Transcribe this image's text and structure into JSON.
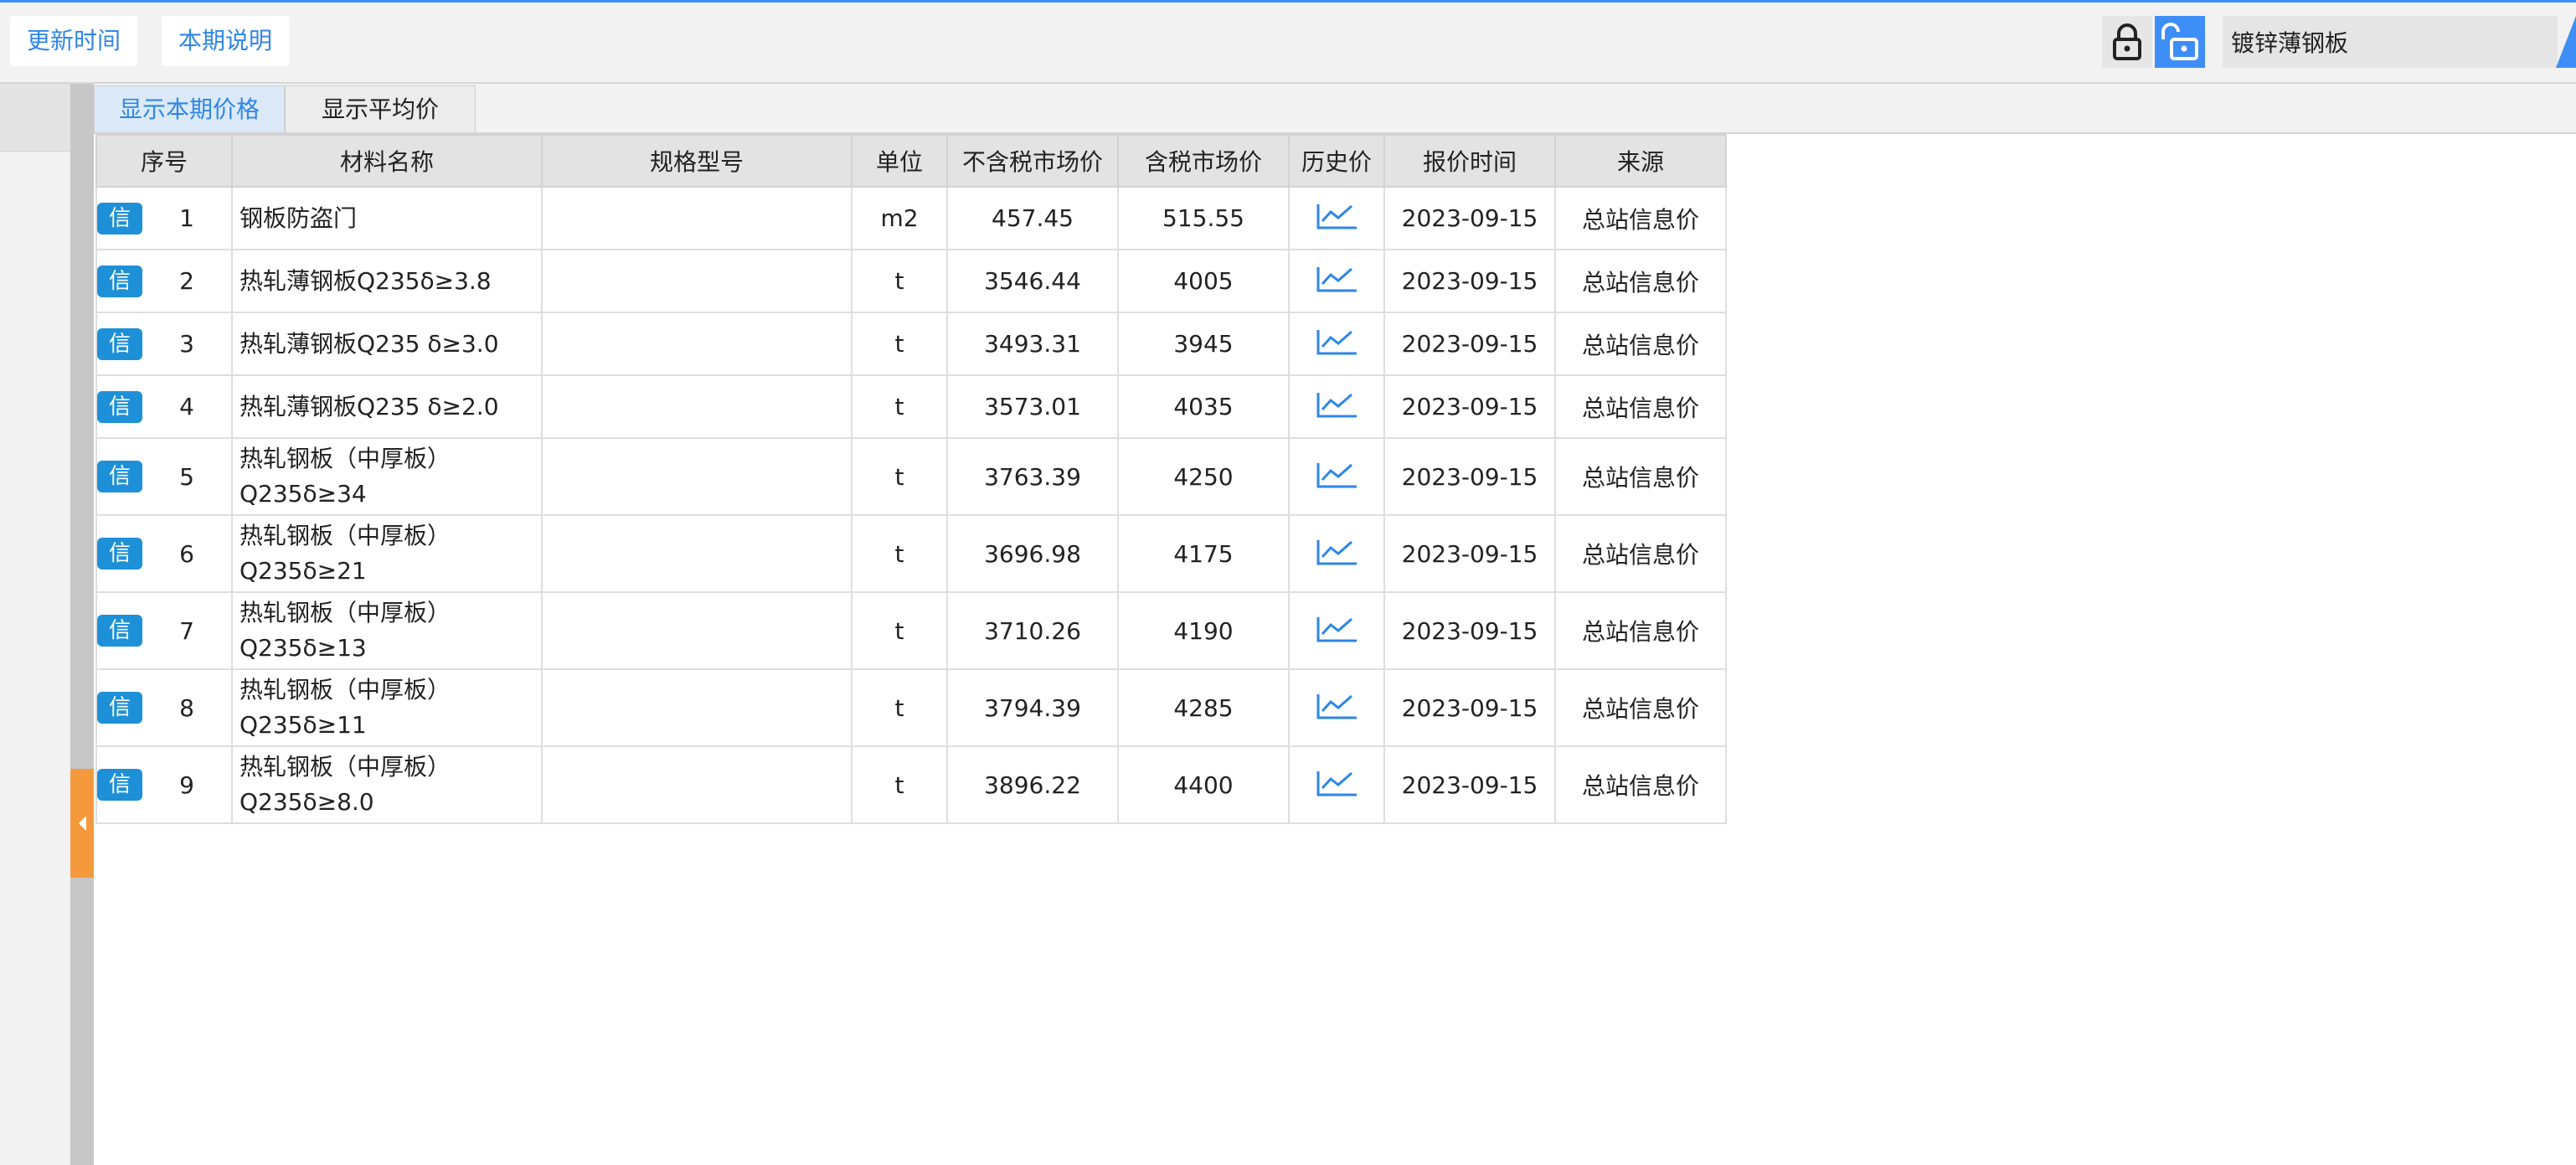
{
  "toolbar": {
    "update_label": "更新时间",
    "notes_label": "本期说明",
    "search_value": "镀锌薄钢板"
  },
  "tabs": {
    "current": "显示本期价格",
    "average": "显示平均价"
  },
  "table": {
    "headers": [
      "序号",
      "材料名称",
      "规格型号",
      "单位",
      "不含税市场价",
      "含税市场价",
      "历史价",
      "报价时间",
      "来源"
    ],
    "badge": "信",
    "rows": [
      {
        "seq": "1",
        "name_line1": "钢板防盗门",
        "name_line2": "",
        "spec": "",
        "unit": "m2",
        "price_ex": "457.45",
        "price_inc": "515.55",
        "date": "2023-09-15",
        "source": "总站信息价"
      },
      {
        "seq": "2",
        "name_line1": "热轧薄钢板Q235δ≥3.8",
        "name_line2": "",
        "spec": "",
        "unit": "t",
        "price_ex": "3546.44",
        "price_inc": "4005",
        "date": "2023-09-15",
        "source": "总站信息价"
      },
      {
        "seq": "3",
        "name_line1": "热轧薄钢板Q235 δ≥3.0",
        "name_line2": "",
        "spec": "",
        "unit": "t",
        "price_ex": "3493.31",
        "price_inc": "3945",
        "date": "2023-09-15",
        "source": "总站信息价"
      },
      {
        "seq": "4",
        "name_line1": "热轧薄钢板Q235 δ≥2.0",
        "name_line2": "",
        "spec": "",
        "unit": "t",
        "price_ex": "3573.01",
        "price_inc": "4035",
        "date": "2023-09-15",
        "source": "总站信息价"
      },
      {
        "seq": "5",
        "name_line1": "热轧钢板（中厚板）",
        "name_line2": "Q235δ≥34",
        "spec": "",
        "unit": "t",
        "price_ex": "3763.39",
        "price_inc": "4250",
        "date": "2023-09-15",
        "source": "总站信息价"
      },
      {
        "seq": "6",
        "name_line1": "热轧钢板（中厚板）",
        "name_line2": "Q235δ≥21",
        "spec": "",
        "unit": "t",
        "price_ex": "3696.98",
        "price_inc": "4175",
        "date": "2023-09-15",
        "source": "总站信息价"
      },
      {
        "seq": "7",
        "name_line1": "热轧钢板（中厚板）",
        "name_line2": "Q235δ≥13",
        "spec": "",
        "unit": "t",
        "price_ex": "3710.26",
        "price_inc": "4190",
        "date": "2023-09-15",
        "source": "总站信息价"
      },
      {
        "seq": "8",
        "name_line1": "热轧钢板（中厚板）",
        "name_line2": "Q235δ≥11",
        "spec": "",
        "unit": "t",
        "price_ex": "3794.39",
        "price_inc": "4285",
        "date": "2023-09-15",
        "source": "总站信息价"
      },
      {
        "seq": "9",
        "name_line1": "热轧钢板（中厚板）",
        "name_line2": "Q235δ≥8.0",
        "spec": "",
        "unit": "t",
        "price_ex": "3896.22",
        "price_inc": "4400",
        "date": "2023-09-15",
        "source": "总站信息价"
      }
    ]
  },
  "colors": {
    "accent": "#3e8ef7",
    "badge": "#1e90d8",
    "handle": "#f59a3c"
  },
  "icons": [
    "lock-closed-icon",
    "lock-open-icon",
    "trend-chart-icon",
    "collapse-arrow-icon"
  ]
}
